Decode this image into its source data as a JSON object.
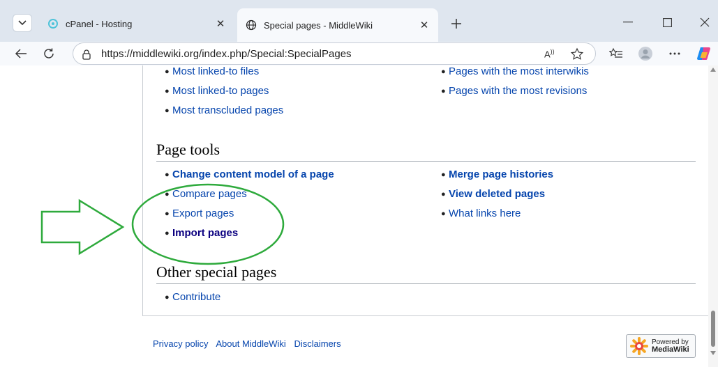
{
  "browser": {
    "tabs": [
      {
        "title": "cPanel - Hosting",
        "active": false
      },
      {
        "title": "Special pages - MiddleWiki",
        "active": true
      }
    ],
    "address": {
      "url": "https://middlewiki.org/index.php/Special:SpecialPages",
      "readaloud": "A··"
    },
    "window_controls": {
      "minimize": "—",
      "close": "✕"
    }
  },
  "page": {
    "top_list_left": [
      {
        "label": "Most linked-to files",
        "style": "link"
      },
      {
        "label": "Most linked-to pages",
        "style": "link"
      },
      {
        "label": "Most transcluded pages",
        "style": "link"
      }
    ],
    "top_list_right": [
      {
        "label": "Pages with the most interwikis",
        "style": "link"
      },
      {
        "label": "Pages with the most revisions",
        "style": "link"
      }
    ],
    "sections": [
      {
        "heading": "Page tools",
        "left": [
          {
            "label": "Change content model of a page",
            "style": "bold"
          },
          {
            "label": "Compare pages",
            "style": "link"
          },
          {
            "label": "Export pages",
            "style": "link"
          },
          {
            "label": "Import pages",
            "style": "bold-visited"
          }
        ],
        "right": [
          {
            "label": "Merge page histories",
            "style": "bold"
          },
          {
            "label": "View deleted pages",
            "style": "bold"
          },
          {
            "label": "What links here",
            "style": "link"
          }
        ]
      },
      {
        "heading": "Other special pages",
        "left": [
          {
            "label": "Contribute",
            "style": "link"
          }
        ],
        "right": []
      }
    ],
    "footer": {
      "links": [
        "Privacy policy",
        "About MiddleWiki",
        "Disclaimers"
      ],
      "badge_line1": "Powered by",
      "badge_line2": "MediaWiki"
    }
  },
  "colors": {
    "link": "#0645ad",
    "visited": "#0b0080",
    "annotation": "#2eaa3c"
  }
}
